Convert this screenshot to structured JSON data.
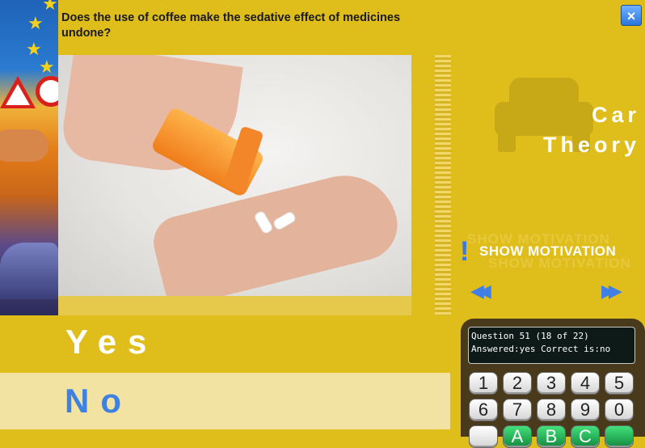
{
  "question": "Does the use of coffee make the sedative effect of medicines undone?",
  "close_label": "×",
  "brand": {
    "line1": "Car",
    "line2": "Theory"
  },
  "motivation": {
    "label": "SHOW MOTIVATION",
    "ghost": "SHOW MOTIVATION",
    "icon": "!"
  },
  "nav": {
    "prev": "◀◀",
    "next": "▶▶"
  },
  "answers": {
    "yes": "Yes",
    "no": "No"
  },
  "status": {
    "line1": "Question 51 (18 of 22)",
    "line2": "Answered:yes Correct is:no"
  },
  "keypad": {
    "row1": [
      "1",
      "2",
      "3",
      "4",
      "5"
    ],
    "row2": [
      "6",
      "7",
      "8",
      "9",
      "0"
    ],
    "row3": [
      "",
      "A",
      "B",
      "C",
      ""
    ]
  }
}
